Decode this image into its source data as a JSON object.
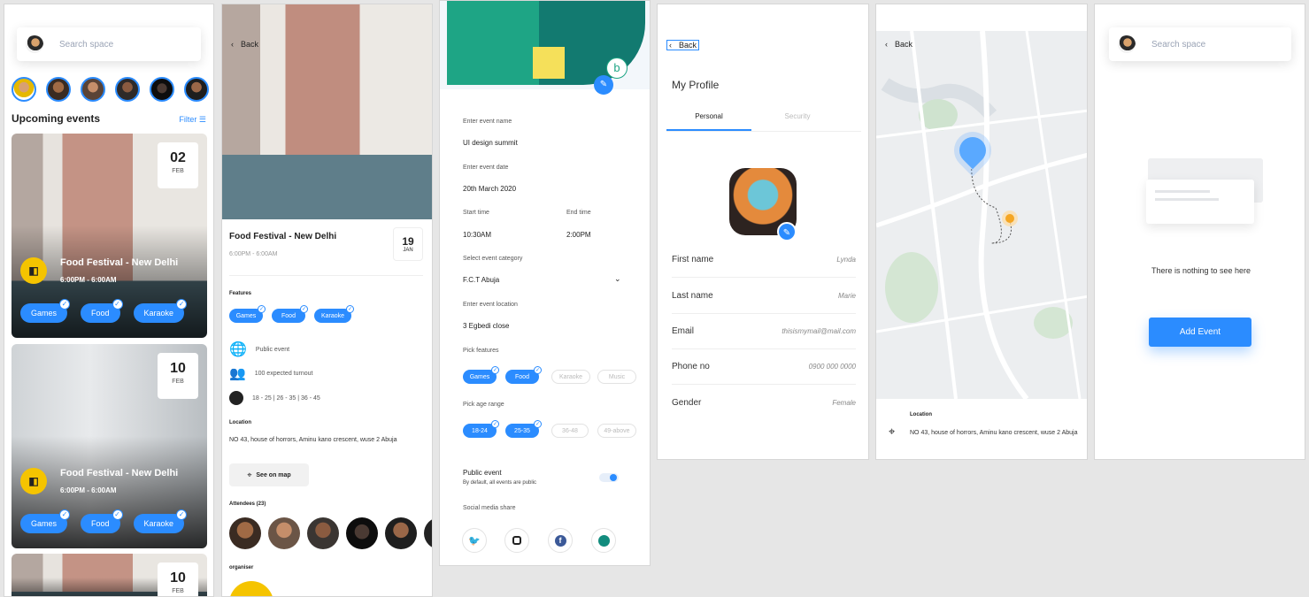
{
  "colors": {
    "accent": "#2b8cff",
    "brand_yellow": "#f5c400"
  },
  "home": {
    "search_placeholder": "Search space",
    "section_title": "Upcoming events",
    "filter_label": "Filter",
    "cards": [
      {
        "day": "02",
        "month": "FEB",
        "title": "Food Festival - New Delhi",
        "time": "6:00PM - 6:00AM",
        "chips": [
          "Games",
          "Food",
          "Karaoke"
        ]
      },
      {
        "day": "10",
        "month": "FEB",
        "title": "Food Festival - New Delhi",
        "time": "6:00PM - 6:00AM",
        "chips": [
          "Games",
          "Food",
          "Karaoke"
        ]
      },
      {
        "day": "10",
        "month": "FEB"
      }
    ]
  },
  "detail": {
    "back_label": "Back",
    "title": "Food Festival - New Delhi",
    "time": "6:00PM - 6:00AM",
    "day": "19",
    "month": "JAN",
    "features_label": "Features",
    "chips": [
      "Games",
      "Food",
      "Karaoke"
    ],
    "public_label": "Public event",
    "turnout": "100 expected turnout",
    "ages": "18 - 25 | 26 - 35 | 36 - 45",
    "location_label": "Location",
    "address": "NO 43, house of horrors, Aminu kano crescent, wuse 2 Abuja",
    "map_button": "See on map",
    "attendees_label": "Attendees (23)",
    "organiser_label": "organiser"
  },
  "form": {
    "name_label": "Enter event name",
    "name_value": "UI design summit",
    "date_label": "Enter event date",
    "date_value": "20th March 2020",
    "start_label": "Start time",
    "start_value": "10:30AM",
    "end_label": "End time",
    "end_value": "2:00PM",
    "category_label": "Select event category",
    "category_value": "F.C.T Abuja",
    "location_label": "Enter event location",
    "location_value": "3 Egbedi close",
    "features_label": "Pick features",
    "features": [
      "Games",
      "Food",
      "Karaoke",
      "Music"
    ],
    "age_label": "Pick age range",
    "ages": [
      "18-24",
      "25-35",
      "36-48",
      "49-above"
    ],
    "public_title": "Public event",
    "public_sub": "By default, all events are public",
    "social_label": "Social media share",
    "social_icons": [
      "twitter-icon",
      "instagram-icon",
      "facebook-icon",
      "whatsapp-icon"
    ]
  },
  "profile": {
    "back_label": "Back",
    "title": "My Profile",
    "tabs": [
      "Personal",
      "Security"
    ],
    "rows": [
      {
        "key": "First name",
        "value": "Lynda"
      },
      {
        "key": "Last name",
        "value": "Marie"
      },
      {
        "key": "Email",
        "value": "thisismymail@mail.com"
      },
      {
        "key": "Phone no",
        "value": "0900 000 0000"
      },
      {
        "key": "Gender",
        "value": "Female"
      }
    ]
  },
  "mapscreen": {
    "back_label": "Back",
    "location_label": "Location",
    "address": "NO 43, house of horrors, Aminu kano crescent, wuse 2 Abuja"
  },
  "empty": {
    "search_placeholder": "Search space",
    "message": "There is nothing to see here",
    "button": "Add Event"
  }
}
